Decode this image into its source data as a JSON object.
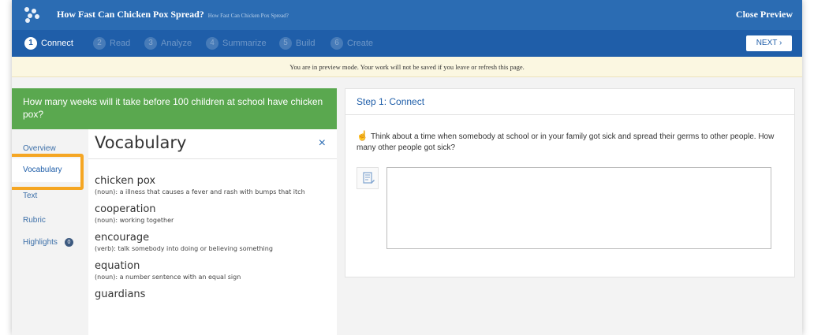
{
  "header": {
    "title": "How Fast Can Chicken Pox Spread?",
    "subtitle": "How Fast Can Chicken Pox Spread?",
    "close_label": "Close Preview"
  },
  "steps": [
    {
      "num": "1",
      "label": "Connect",
      "active": true
    },
    {
      "num": "2",
      "label": "Read"
    },
    {
      "num": "3",
      "label": "Analyze"
    },
    {
      "num": "4",
      "label": "Summarize"
    },
    {
      "num": "5",
      "label": "Build"
    },
    {
      "num": "6",
      "label": "Create"
    }
  ],
  "next_label": "NEXT ›",
  "banner": "You are in preview mode. Your work will not be saved if you leave or refresh this page.",
  "question": "How many weeks will it take before 100 children at school have chicken pox?",
  "nav": {
    "items": [
      {
        "label": "Overview"
      },
      {
        "label": "Vocabulary",
        "active": true
      },
      {
        "label": "Text"
      },
      {
        "label": "Rubric"
      },
      {
        "label": "Highlights",
        "badge": "0"
      }
    ]
  },
  "vocab": {
    "title": "Vocabulary",
    "close": "×",
    "terms": [
      {
        "word": "chicken pox",
        "def": "(noun): a illness that causes a fever and rash with bumps that itch"
      },
      {
        "word": "cooperation",
        "def": "(noun): working together"
      },
      {
        "word": "encourage",
        "def": "(verb): talk somebody into doing or believing something"
      },
      {
        "word": "equation",
        "def": "(noun): a number sentence with an equal sign"
      },
      {
        "word": "guardians",
        "def": ""
      }
    ]
  },
  "step_panel": {
    "header": "Step 1: Connect",
    "prompt_icon": "☝",
    "prompt": "Think about a time when somebody at school or in your family got sick and spread their germs to other people. How many other people got sick?",
    "answer_value": ""
  }
}
